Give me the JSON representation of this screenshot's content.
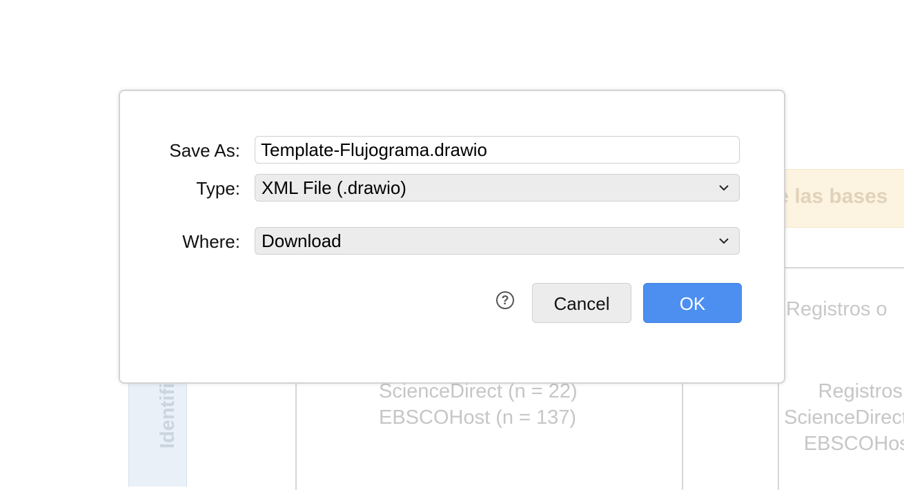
{
  "background": {
    "header_text": "de las bases",
    "registros_label": "Registros o",
    "sidebar_label": "Identificación",
    "mid_lines": [
      "ScienceDirect (n = 22)",
      "EBSCOHost (n = 137)"
    ],
    "right_lines": [
      "Registros",
      "ScienceDirect",
      "EBSCOHost"
    ]
  },
  "dialog": {
    "save_as_label": "Save As:",
    "filename_value": "Template-Flujograma.drawio",
    "type_label": "Type:",
    "type_value": "XML File (.drawio)",
    "where_label": "Where:",
    "where_value": "Download",
    "help_symbol": "?",
    "cancel_label": "Cancel",
    "ok_label": "OK",
    "ok_color": "#4c8ff0"
  }
}
